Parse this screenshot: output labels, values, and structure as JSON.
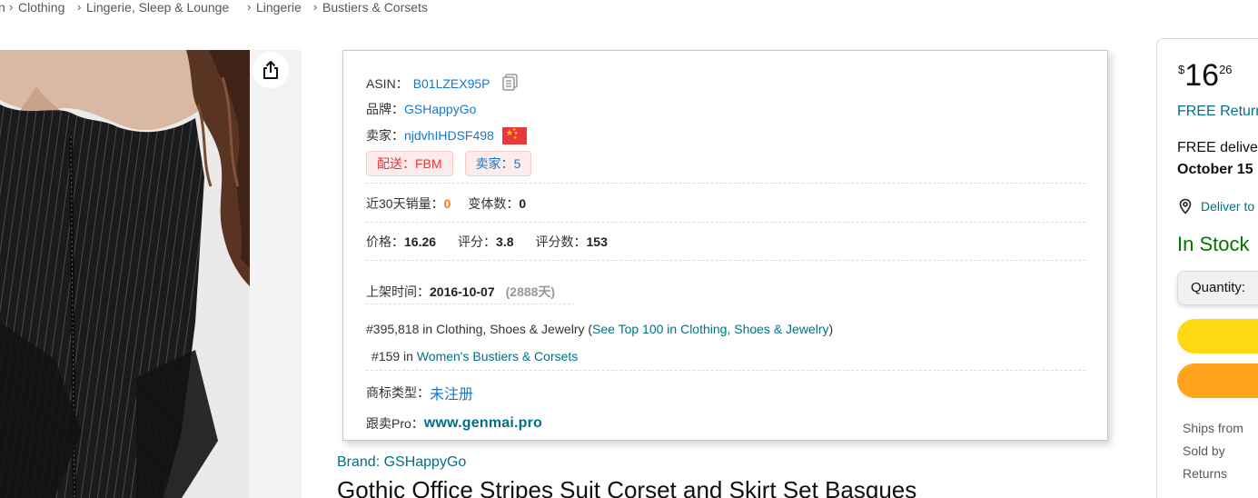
{
  "breadcrumb": {
    "items": [
      "n",
      "Clothing",
      "Lingerie, Sleep & Lounge",
      "Lingerie",
      "Bustiers & Corsets"
    ],
    "separator": "›"
  },
  "plugin": {
    "asin_label": "ASIN：",
    "asin": "B01LZEX95P",
    "brand_label": "品牌：",
    "brand": "GSHappyGo",
    "seller_label": "卖家：",
    "seller": "njdvhIHDSF498",
    "fulfillment_pill": "配送：FBM",
    "sellers_pill_label": "卖家：",
    "sellers_count": "5",
    "sales30_label": "近30天销量：",
    "sales30": "0",
    "variants_label": "变体数：",
    "variants": "0",
    "price_label": "价格：",
    "price": "16.26",
    "rating_label": "评分：",
    "rating": "3.8",
    "reviews_label": "评分数：",
    "reviews": "153",
    "listed_label": "上架时间：",
    "listed_date": "2016-10-07",
    "listed_days": "(2888天)",
    "rank1_prefix": "#395,818 in Clothing, Shoes & Jewelry (",
    "rank1_link": "See Top 100 in Clothing, Shoes & Jewelry",
    "rank1_suffix": ")",
    "rank2_prefix": "#159 in ",
    "rank2_link": "Women's Bustiers & Corsets",
    "trademark_label": "商标类型：",
    "trademark": "未注册",
    "follow_label": "跟卖Pro：",
    "follow_site": "www.genmai.pro"
  },
  "product": {
    "brand_link": "Brand: GSHappyGo",
    "title": "Gothic Office Stripes Suit Corset and Skirt Set Basques"
  },
  "buybox": {
    "price_symbol": "$",
    "price_whole": "16",
    "price_fraction": "26",
    "free_returns": "FREE Returns",
    "free_delivery": "FREE delivery",
    "delivery_date": "October 15",
    "deliver_to": "Deliver to",
    "in_stock": "In Stock",
    "quantity_label": "Quantity:",
    "ships_from": "Ships from",
    "sold_by": "Sold by",
    "returns": "Returns"
  },
  "colors": {
    "link_blue": "#1677c9",
    "amazon_teal": "#007185",
    "in_stock_green": "#007600",
    "add_to_cart": "#ffd814",
    "buy_now": "#ffa41c",
    "orange_value": "#f0782d"
  }
}
